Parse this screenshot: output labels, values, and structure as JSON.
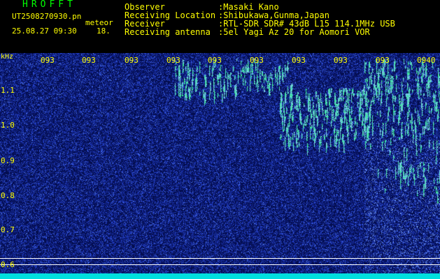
{
  "header": {
    "app_title": "HROFFT",
    "file_name": "UT2508270930.pn",
    "mode_label": "meteor",
    "timestamp": "25.08.27 09:30",
    "count": "18."
  },
  "info": [
    {
      "label": "Observer",
      "value": ":Masaki Kano"
    },
    {
      "label": "Receiving Location",
      "value": ":Shibukawa,Gunma,Japan"
    },
    {
      "label": "Receiver",
      "value": ":RTL-SDR SDR# 43dB L15 114.1MHz USB"
    },
    {
      "label": "Receiving antenna",
      "value": ":5el Yagi Az 20 for Aomori VOR"
    }
  ],
  "spectrogram": {
    "y_unit_label": "kHz",
    "y_ticks": [
      "1.1",
      "1.0",
      "0.9",
      "0.8",
      "0.7",
      "0.6"
    ],
    "y_range_khz": [
      0.58,
      1.2
    ],
    "x_tick_labels": [
      "093",
      "093",
      "093",
      "093",
      "093",
      "093",
      "093",
      "093",
      "093",
      "0940"
    ],
    "colors": {
      "background": "#04105a",
      "noise": "#2840d0",
      "signal": "#40e8a0",
      "baseline": "#00dede",
      "text": "#ffff00",
      "title": "#00ff00"
    }
  }
}
